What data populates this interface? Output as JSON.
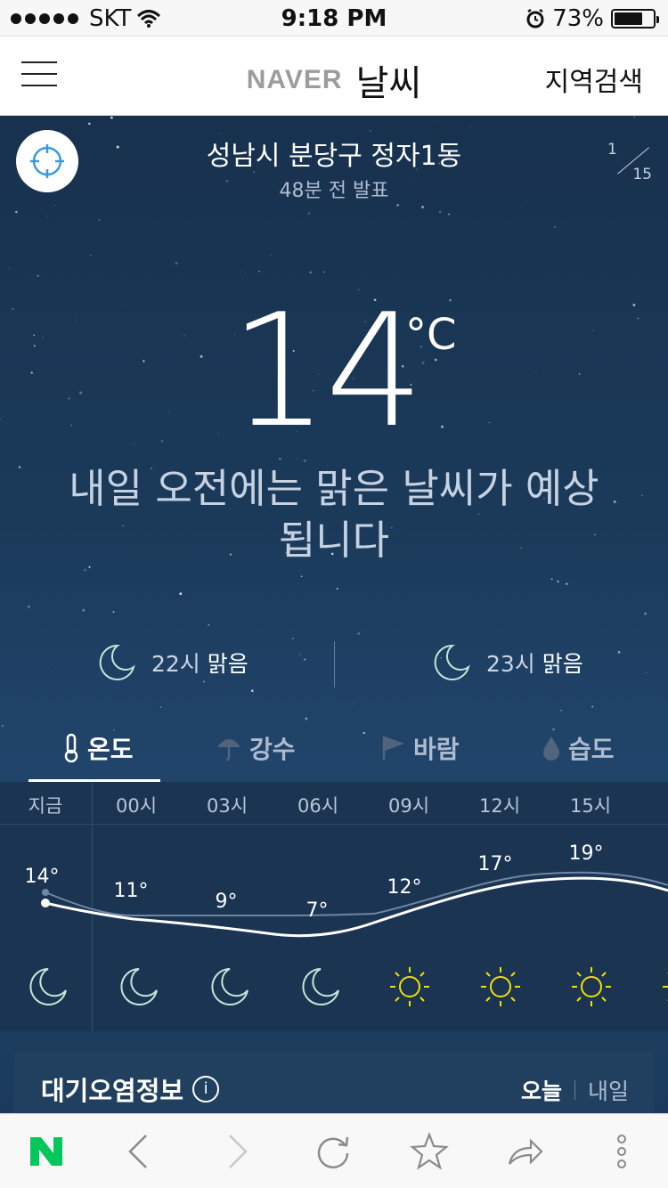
{
  "status_bar": {
    "carrier": "SKT",
    "time": "9:18 PM",
    "battery": "73%",
    "battery_level": 0.73
  },
  "header": {
    "brand": "NAVER",
    "title": "날씨",
    "region_search": "지역검색"
  },
  "location": {
    "name": "성남시 분당구 정자1동",
    "published": "48분 전 발표",
    "page_current": "1",
    "page_total": "15"
  },
  "current": {
    "temperature": "14",
    "unit": "°C",
    "description": "내일 오전에는 맑은 날씨가 예상됩니다"
  },
  "short_forecast": [
    {
      "time": "22시",
      "condition": "맑음",
      "icon": "moon-icon"
    },
    {
      "time": "23시",
      "condition": "맑음",
      "icon": "moon-icon"
    }
  ],
  "tabs": [
    {
      "label": "온도",
      "icon": "thermometer-icon",
      "active": true
    },
    {
      "label": "강수",
      "icon": "umbrella-icon",
      "active": false
    },
    {
      "label": "바람",
      "icon": "flag-icon",
      "active": false
    },
    {
      "label": "습도",
      "icon": "drop-icon",
      "active": false
    }
  ],
  "hourly": [
    {
      "hour": "지금",
      "temp": "14°",
      "icon": "moon-icon"
    },
    {
      "hour": "00시",
      "temp": "11°",
      "icon": "moon-icon"
    },
    {
      "hour": "03시",
      "temp": "9°",
      "icon": "moon-icon"
    },
    {
      "hour": "06시",
      "temp": "7°",
      "icon": "moon-icon"
    },
    {
      "hour": "09시",
      "temp": "12°",
      "icon": "sun-icon"
    },
    {
      "hour": "12시",
      "temp": "17°",
      "icon": "sun-icon"
    },
    {
      "hour": "15시",
      "temp": "19°",
      "icon": "sun-icon"
    }
  ],
  "air_quality": {
    "title": "대기오염정보",
    "today": "오늘",
    "tomorrow": "내일"
  },
  "colors": {
    "sun": "#f4e000",
    "moon": "#bfe8d8",
    "naver_green": "#03c75a"
  }
}
